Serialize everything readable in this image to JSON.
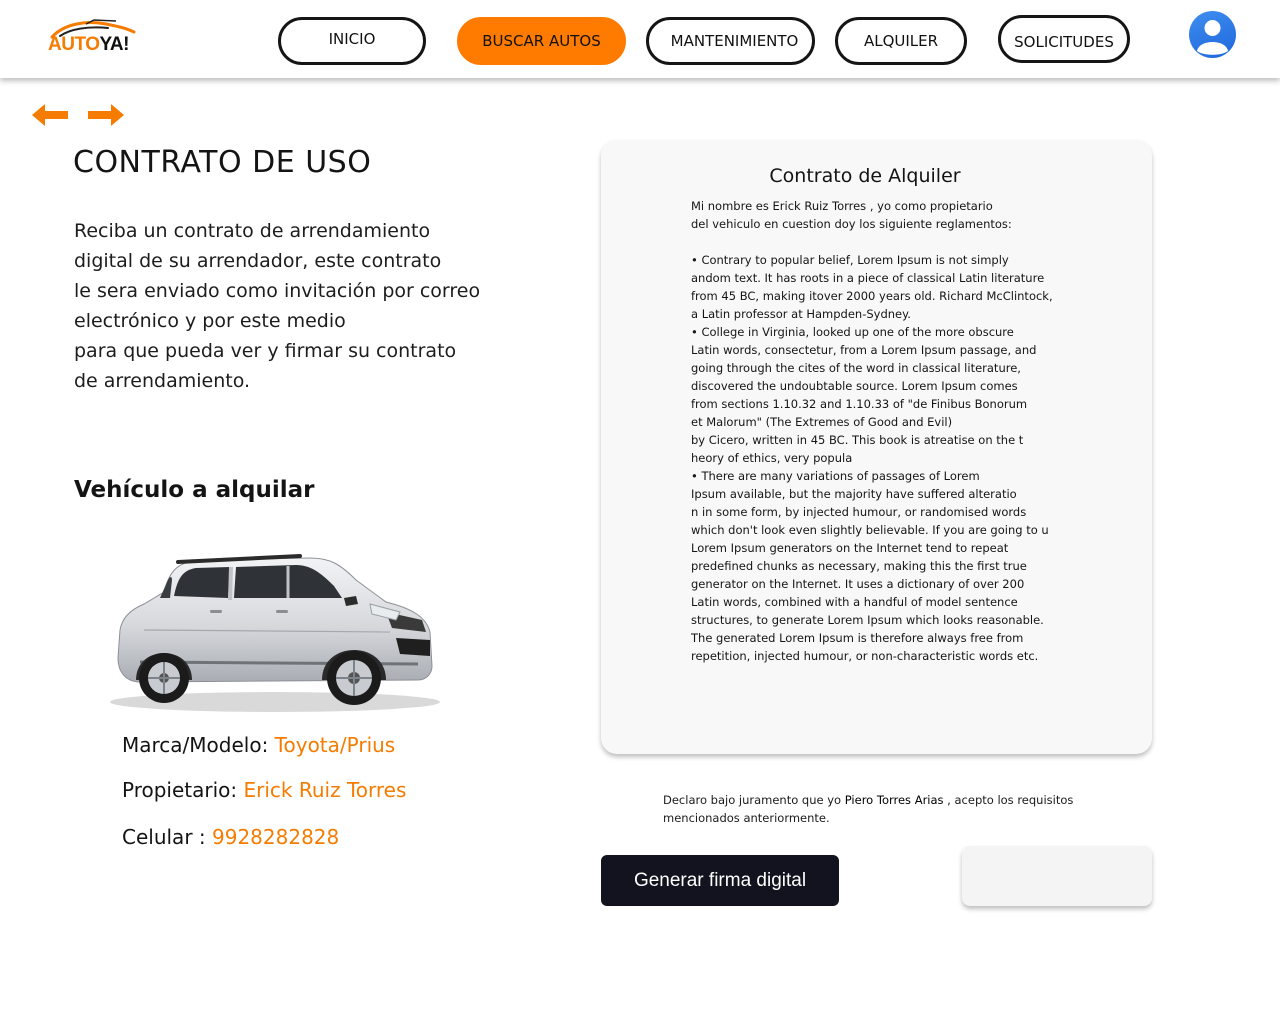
{
  "header": {
    "logo": {
      "text_left": "AUTO",
      "text_right": "YA!"
    },
    "nav": [
      {
        "label": "INICIO"
      },
      {
        "label": "BUSCAR AUTOS"
      },
      {
        "label": "MANTENIMIENTO"
      },
      {
        "label": "ALQUILER"
      },
      {
        "label": "SOLICITUDES"
      }
    ],
    "active_nav": "BUSCAR AUTOS",
    "avatar_icon": "user-avatar-icon"
  },
  "navigation_arrows": {
    "back_icon": "arrow-left-icon",
    "forward_icon": "arrow-right-icon",
    "color": "#f57c00"
  },
  "main": {
    "title": "CONTRATO DE USO",
    "intro_lines": [
      "Reciba un contrato de arrendamiento",
      "digital de su arrendador, este contrato",
      "le sera enviado como invitación por correo",
      "electrónico y por este medio",
      "para que pueda ver y firmar su contrato",
      "de arrendamiento."
    ],
    "vehicle_heading": "Vehículo a alquilar",
    "vehicle_image": "silver-suv-image",
    "vehicle": {
      "brand_label": "Marca/Modelo: ",
      "brand_value": "Toyota/Prius",
      "owner_label": "Propietario: ",
      "owner_value": "Erick Ruiz Torres",
      "phone_label": "Celular : ",
      "phone_value": "9928282828"
    }
  },
  "contract": {
    "title": "Contrato de Alquiler",
    "lines": [
      "Mi nombre es Erick Ruiz Torres , yo como propietario",
      "del vehiculo en cuestion doy los siguiente  reglamentos:",
      "",
      " •  Contrary to popular belief, Lorem Ipsum is not simply",
      "andom text. It has roots in a piece of classical Latin literature",
      " from 45 BC, making itover 2000 years old. Richard McClintock,",
      "a Latin professor at Hampden-Sydney.",
      " •   College in Virginia, looked up one of the more obscure",
      " Latin words, consectetur, from a Lorem Ipsum passage, and",
      "going through the cites of the word in classical literature,",
      "discovered the undoubtable source. Lorem Ipsum comes",
      " from sections 1.10.32 and 1.10.33 of \"de Finibus Bonorum",
      " et Malorum\" (The Extremes of Good and Evil)",
      " by Cicero, written in 45 BC. This book is atreatise on the t",
      "heory of ethics, very popula",
      " •  There are many variations of passages of Lorem",
      " Ipsum available, but the majority have suffered alteratio",
      "n in some form, by injected humour, or randomised words",
      "which don't look even slightly believable. If you are going to u",
      "Lorem Ipsum generators on the Internet tend to repeat",
      "predefined chunks as necessary, making this the first true",
      " generator on the Internet. It uses a dictionary of over 200",
      "Latin words, combined with a handful of model sentence",
      "structures, to generate Lorem Ipsum which looks reasonable.",
      " The generated Lorem Ipsum is therefore always free from",
      " repetition, injected humour, or non-characteristic words etc."
    ]
  },
  "declaration": {
    "prefix": "Declaro bajo juramento que yo ",
    "name": "Piero Torres Arias",
    "suffix": " , acepto los requisitos",
    "line2": "mencionados anteriormente."
  },
  "actions": {
    "generate_signature_label": "Generar firma digital",
    "signature_box_value": ""
  },
  "colors": {
    "accent": "#ff7b00",
    "accent_text": "#f57c00",
    "dark_button": "#13121f",
    "card_bg": "#f8f8f8"
  }
}
